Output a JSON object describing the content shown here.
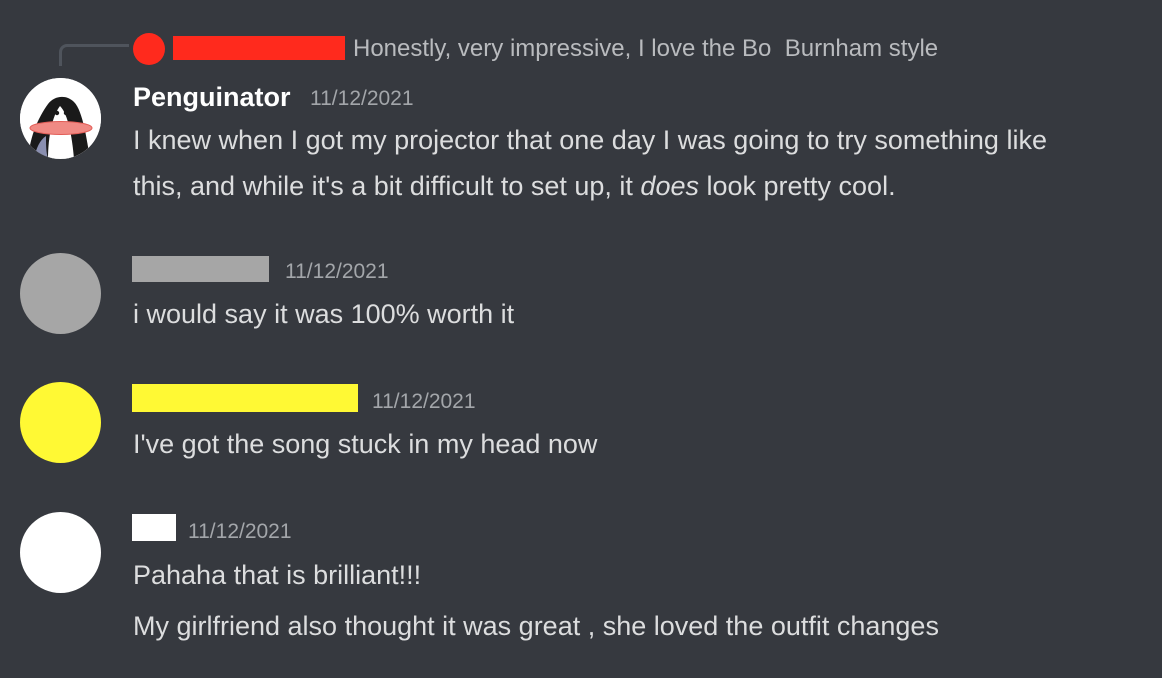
{
  "reply": {
    "text": "Honestly, very impressive, I love the Bo  Burnham style",
    "avatar_color": "#ff2a1d",
    "name_redaction_color": "#ff2a1d"
  },
  "messages": [
    {
      "username": "Penguinator",
      "timestamp": "11/12/2021",
      "avatar_icon": "penguin-avatar-icon",
      "lines": [
        "I knew when I got my projector that one day I was going to try something like",
        {
          "before": "this, and while it's a bit difficult to set up, it ",
          "emphasis": "does",
          "after": " look pretty cool."
        }
      ]
    },
    {
      "username_redaction_color": "#a6a6a6",
      "avatar_color": "#a6a6a6",
      "timestamp": "11/12/2021",
      "lines": [
        "i would say it was 100% worth it"
      ]
    },
    {
      "username_redaction_color": "#fff934",
      "avatar_color": "#fff934",
      "timestamp": "11/12/2021",
      "lines": [
        "I've got the song stuck in my head now"
      ]
    },
    {
      "username_redaction_color": "#ffffff",
      "avatar_color": "#ffffff",
      "timestamp": "11/12/2021",
      "lines": [
        "Pahaha that is brilliant!!!",
        "My girlfriend also thought it was great , she loved the outfit changes"
      ]
    }
  ],
  "colors": {
    "background": "#36393f",
    "message_text": "#dcddde",
    "timestamp": "#a3a6aa",
    "reply_text": "#b9bbbe",
    "username": "#ffffff"
  }
}
